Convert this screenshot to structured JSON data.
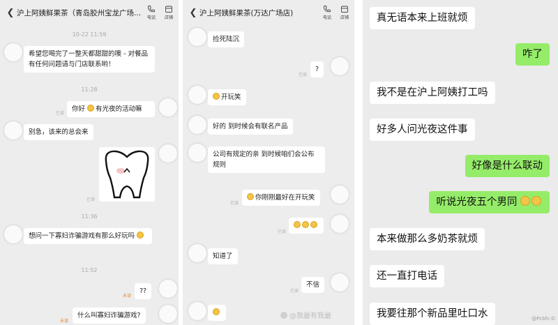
{
  "panel1": {
    "title": "沪上阿姨鲜果茶（青岛胶州宝龙广场...",
    "actions": [
      {
        "label": "电话",
        "icon": "phone-icon"
      },
      {
        "label": "店铺",
        "icon": "store-icon"
      }
    ],
    "timestamps": [
      "10-22 11:59",
      "11:28",
      "11:36",
      "11:52"
    ],
    "messages": [
      {
        "side": "in",
        "text": "希望您喝完了一整天都甜甜的噢 - 对餐品有任何问题请与门店联系哟！"
      },
      {
        "side": "out",
        "text": "有光夜的活动嘛",
        "prefix_prev": "你好",
        "status": "已读"
      },
      {
        "side": "in",
        "text": "别急，该来的总会来"
      },
      {
        "side": "out",
        "type": "sticker",
        "status": "已读"
      },
      {
        "side": "in",
        "text": "想问一下寡妇诈骗游戏有那么好玩吗"
      },
      {
        "side": "out",
        "text": "??",
        "status": "未读"
      },
      {
        "side": "out",
        "text": "什么叫寡妇诈骗游戏?",
        "status": "未读"
      }
    ]
  },
  "panel2": {
    "title": "沪上阿姨鲜果茶(万达广场店)",
    "actions": [
      {
        "label": "电话",
        "icon": "phone-icon"
      },
      {
        "label": "店铺",
        "icon": "store-icon"
      }
    ],
    "messages": [
      {
        "side": "in",
        "text": "捡死陆沉"
      },
      {
        "side": "out",
        "text": "?",
        "status": "已读"
      },
      {
        "side": "in",
        "text": "开玩笑"
      },
      {
        "side": "in",
        "text": "好的 到时候会有联名产品"
      },
      {
        "side": "in",
        "text": "公司有规定的亲 到时候咱们会公布规则"
      },
      {
        "side": "out",
        "text": "你刚刚最好在开玩笑",
        "status": "已读"
      },
      {
        "side": "out",
        "text": "",
        "status": "已读"
      },
      {
        "side": "in",
        "text": "知道了"
      },
      {
        "side": "out",
        "text": "不信",
        "status": "已读"
      },
      {
        "side": "in",
        "text": ""
      }
    ],
    "watermark": "@我最有我最"
  },
  "panel3": {
    "messages": [
      {
        "side": "in",
        "text": "真无语本来上班就烦"
      },
      {
        "side": "out",
        "text": "咋了"
      },
      {
        "side": "in",
        "text": "我不是在沪上阿姨打工吗"
      },
      {
        "side": "in",
        "text": "好多人问光夜这件事"
      },
      {
        "side": "out",
        "text": "好像是什么联动"
      },
      {
        "side": "out",
        "text": "听说光夜五个男同"
      },
      {
        "side": "in",
        "text": "本来做那么多奶茶就烦"
      },
      {
        "side": "in",
        "text": "还一直打电话"
      },
      {
        "side": "in",
        "text": "我要往那个新品里吐口水"
      }
    ],
    "watermark": "@Pcbfc-D"
  },
  "colors": {
    "chat_bg": "#ededed",
    "bubble_in": "#ffffff",
    "bubble_out_wechat": "#95ec69",
    "unread_tag": "#e28a3c",
    "read_tag": "#b0b0b0"
  }
}
